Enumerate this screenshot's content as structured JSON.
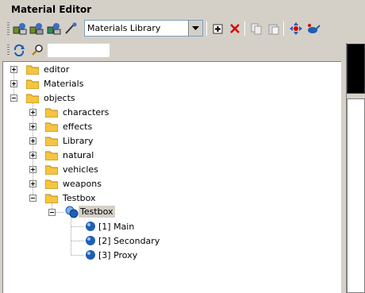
{
  "window": {
    "title": "Material Editor"
  },
  "toolbar": {
    "library_select": "Materials Library",
    "buttons": [
      {
        "icon": "assign-material-icon"
      },
      {
        "icon": "get-material-icon"
      },
      {
        "icon": "pick-material-icon"
      },
      {
        "icon": "eyedropper-icon"
      },
      {
        "icon": "add-icon"
      },
      {
        "icon": "delete-icon"
      },
      {
        "icon": "copy-icon"
      },
      {
        "icon": "paste-icon"
      },
      {
        "icon": "move-icon"
      },
      {
        "icon": "watering-can-icon"
      },
      {
        "icon": "refresh-icon"
      },
      {
        "icon": "search-icon"
      }
    ],
    "search_value": ""
  },
  "tree": {
    "items": [
      {
        "label": "editor"
      },
      {
        "label": "Materials"
      },
      {
        "label": "objects"
      },
      {
        "label": "characters"
      },
      {
        "label": "effects"
      },
      {
        "label": "Library"
      },
      {
        "label": "natural"
      },
      {
        "label": "vehicles"
      },
      {
        "label": "weapons"
      },
      {
        "label": "Testbox"
      },
      {
        "label": "Testbox"
      },
      {
        "label": "[1] Main"
      },
      {
        "label": "[2] Secondary"
      },
      {
        "label": "[3] Proxy"
      }
    ]
  },
  "colors": {
    "folder": "#f5c542",
    "sphere": "#1e5fb4",
    "selection": "#d4d0c8"
  }
}
